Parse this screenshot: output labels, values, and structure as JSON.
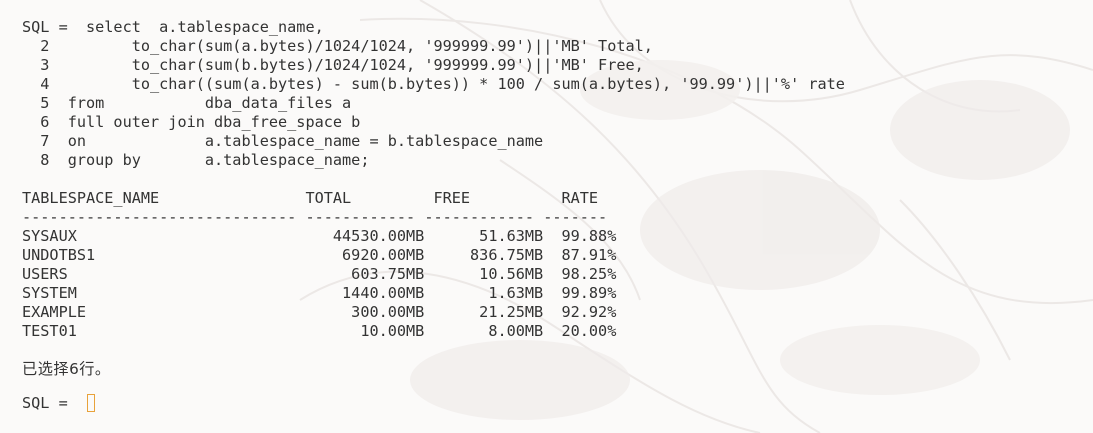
{
  "query_lines": [
    "SQL =  select  a.tablespace_name,",
    "  2         to_char(sum(a.bytes)/1024/1024, '999999.99')||'MB' Total,",
    "  3         to_char(sum(b.bytes)/1024/1024, '999999.99')||'MB' Free,",
    "  4         to_char((sum(a.bytes) - sum(b.bytes)) * 100 / sum(a.bytes), '99.99')||'%' rate",
    "  5  from           dba_data_files a",
    "  6  full outer join dba_free_space b",
    "  7  on             a.tablespace_name = b.tablespace_name",
    "  8  group by       a.tablespace_name;"
  ],
  "result": {
    "header": "TABLESPACE_NAME                TOTAL         FREE          RATE",
    "separator": "------------------------------ ------------ ------------ -------",
    "rows": [
      "SYSAUX                            44530.00MB      51.63MB  99.88%",
      "UNDOTBS1                           6920.00MB     836.75MB  87.91%",
      "USERS                               603.75MB      10.56MB  98.25%",
      "SYSTEM                             1440.00MB       1.63MB  99.89%",
      "EXAMPLE                             300.00MB      21.25MB  92.92%",
      "TEST01                               10.00MB       8.00MB  20.00%"
    ]
  },
  "status_message": "已选择6行。",
  "prompt": "SQL = ",
  "colors": {
    "text": "#333333",
    "background": "#fbfaf9",
    "cursor": "#e8a23a"
  }
}
